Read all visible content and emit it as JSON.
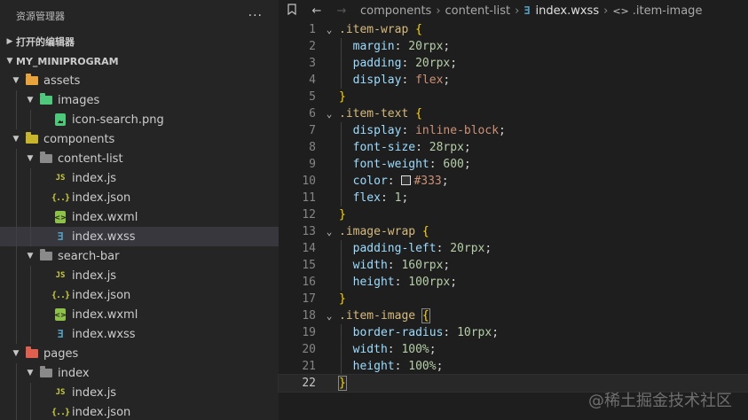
{
  "sidebar": {
    "title": "资源管理器",
    "more": "···",
    "open_editors": "打开的编辑器",
    "project": "MY_MINIPROGRAM",
    "tree": [
      {
        "label": "assets",
        "type": "folder",
        "color": "#e8a33d",
        "depth": 1,
        "open": true
      },
      {
        "label": "images",
        "type": "folder",
        "color": "#4ec97b",
        "depth": 2,
        "open": true
      },
      {
        "label": "icon-search.png",
        "type": "png",
        "depth": 3
      },
      {
        "label": "components",
        "type": "folder",
        "color": "#c9b52b",
        "depth": 1,
        "open": true
      },
      {
        "label": "content-list",
        "type": "folder",
        "color": "#8a8a8a",
        "depth": 2,
        "open": true
      },
      {
        "label": "index.js",
        "type": "js",
        "depth": 3
      },
      {
        "label": "index.json",
        "type": "json",
        "depth": 3
      },
      {
        "label": "index.wxml",
        "type": "wxml",
        "depth": 3
      },
      {
        "label": "index.wxss",
        "type": "wxss",
        "depth": 3,
        "selected": true
      },
      {
        "label": "search-bar",
        "type": "folder",
        "color": "#8a8a8a",
        "depth": 2,
        "open": true
      },
      {
        "label": "index.js",
        "type": "js",
        "depth": 3
      },
      {
        "label": "index.json",
        "type": "json",
        "depth": 3
      },
      {
        "label": "index.wxml",
        "type": "wxml",
        "depth": 3
      },
      {
        "label": "index.wxss",
        "type": "wxss",
        "depth": 3
      },
      {
        "label": "pages",
        "type": "folder",
        "color": "#e0604f",
        "depth": 1,
        "open": true
      },
      {
        "label": "index",
        "type": "folder",
        "color": "#8a8a8a",
        "depth": 2,
        "open": true
      },
      {
        "label": "index.js",
        "type": "js",
        "depth": 3
      },
      {
        "label": "index.json",
        "type": "json",
        "depth": 3
      }
    ]
  },
  "breadcrumb": {
    "parts": [
      "components",
      "content-list"
    ],
    "file": "index.wxss",
    "symbol": ".item-image"
  },
  "code": {
    "current_line": 22,
    "lines": [
      [
        [
          "sel",
          ".item-wrap"
        ],
        [
          "code",
          " "
        ],
        [
          "brace",
          "{"
        ]
      ],
      [
        [
          "code",
          "  "
        ],
        [
          "prop",
          "margin"
        ],
        [
          "code",
          ": "
        ],
        [
          "num",
          "20"
        ],
        [
          "unit",
          "rpx"
        ],
        [
          "code",
          ";"
        ]
      ],
      [
        [
          "code",
          "  "
        ],
        [
          "prop",
          "padding"
        ],
        [
          "code",
          ": "
        ],
        [
          "num",
          "20"
        ],
        [
          "unit",
          "rpx"
        ],
        [
          "code",
          ";"
        ]
      ],
      [
        [
          "code",
          "  "
        ],
        [
          "prop",
          "display"
        ],
        [
          "code",
          ": "
        ],
        [
          "val",
          "flex"
        ],
        [
          "code",
          ";"
        ]
      ],
      [
        [
          "brace",
          "}"
        ]
      ],
      [
        [
          "sel",
          ".item-text"
        ],
        [
          "code",
          " "
        ],
        [
          "brace",
          "{"
        ]
      ],
      [
        [
          "code",
          "  "
        ],
        [
          "prop",
          "display"
        ],
        [
          "code",
          ": "
        ],
        [
          "val",
          "inline-block"
        ],
        [
          "code",
          ";"
        ]
      ],
      [
        [
          "code",
          "  "
        ],
        [
          "prop",
          "font-size"
        ],
        [
          "code",
          ": "
        ],
        [
          "num",
          "28"
        ],
        [
          "unit",
          "rpx"
        ],
        [
          "code",
          ";"
        ]
      ],
      [
        [
          "code",
          "  "
        ],
        [
          "prop",
          "font-weight"
        ],
        [
          "code",
          ": "
        ],
        [
          "num",
          "600"
        ],
        [
          "code",
          ";"
        ]
      ],
      [
        [
          "code",
          "  "
        ],
        [
          "prop",
          "color"
        ],
        [
          "code",
          ": "
        ],
        [
          "swatch",
          ""
        ],
        [
          "val",
          "#333"
        ],
        [
          "code",
          ";"
        ]
      ],
      [
        [
          "code",
          "  "
        ],
        [
          "prop",
          "flex"
        ],
        [
          "code",
          ": "
        ],
        [
          "num",
          "1"
        ],
        [
          "code",
          ";"
        ]
      ],
      [
        [
          "brace",
          "}"
        ]
      ],
      [
        [
          "sel",
          ".image-wrap"
        ],
        [
          "code",
          " "
        ],
        [
          "brace",
          "{"
        ]
      ],
      [
        [
          "code",
          "  "
        ],
        [
          "prop",
          "padding-left"
        ],
        [
          "code",
          ": "
        ],
        [
          "num",
          "20"
        ],
        [
          "unit",
          "rpx"
        ],
        [
          "code",
          ";"
        ]
      ],
      [
        [
          "code",
          "  "
        ],
        [
          "prop",
          "width"
        ],
        [
          "code",
          ": "
        ],
        [
          "num",
          "160"
        ],
        [
          "unit",
          "rpx"
        ],
        [
          "code",
          ";"
        ]
      ],
      [
        [
          "code",
          "  "
        ],
        [
          "prop",
          "height"
        ],
        [
          "code",
          ": "
        ],
        [
          "num",
          "100"
        ],
        [
          "unit",
          "rpx"
        ],
        [
          "code",
          ";"
        ]
      ],
      [
        [
          "brace",
          "}"
        ]
      ],
      [
        [
          "sel",
          ".item-image"
        ],
        [
          "code",
          " "
        ],
        [
          "brace",
          "{"
        ]
      ],
      [
        [
          "code",
          "  "
        ],
        [
          "prop",
          "border-radius"
        ],
        [
          "code",
          ": "
        ],
        [
          "num",
          "10"
        ],
        [
          "unit",
          "rpx"
        ],
        [
          "code",
          ";"
        ]
      ],
      [
        [
          "code",
          "  "
        ],
        [
          "prop",
          "width"
        ],
        [
          "code",
          ": "
        ],
        [
          "num",
          "100%"
        ],
        [
          "code",
          ";"
        ]
      ],
      [
        [
          "code",
          "  "
        ],
        [
          "prop",
          "height"
        ],
        [
          "code",
          ": "
        ],
        [
          "num",
          "100%"
        ],
        [
          "code",
          ";"
        ]
      ],
      [
        [
          "brace",
          "}"
        ]
      ]
    ],
    "fold_lines": [
      1,
      6,
      13,
      18
    ]
  },
  "watermark": "@稀土掘金技术社区"
}
